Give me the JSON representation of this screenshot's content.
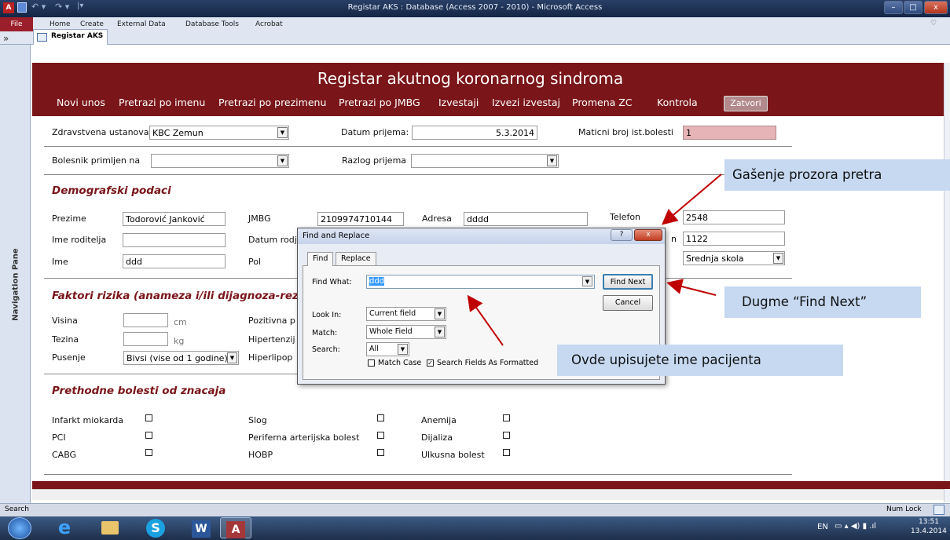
{
  "window": {
    "title": "Registar AKS : Database (Access 2007 - 2010)  -  Microsoft Access"
  },
  "ribbon": {
    "file": "File",
    "tabs": [
      "Home",
      "Create",
      "External Data",
      "Database Tools",
      "Acrobat"
    ]
  },
  "doc_tab": {
    "label": "Registar AKS",
    "chevron": "»"
  },
  "nav_pane": {
    "label": "Navigation Pane"
  },
  "form": {
    "title": "Registar akutnog koronarnog sindroma",
    "menu": [
      "Novi unos",
      "Pretrazi po imenu",
      "Pretrazi po prezimenu",
      "Pretrazi po JMBG",
      "Izvestaji",
      "Izvezi izvestaj",
      "Promena ZC",
      "Kontrola"
    ],
    "close_button": "Zatvori",
    "zdravstvena_label": "Zdravstvena ustanova:",
    "zdravstvena_value": "KBC Zemun",
    "datum_prijema_label": "Datum prijema:",
    "datum_prijema_value": "5.3.2014",
    "maticni_label": "Maticni broj ist.bolesti",
    "maticni_value": "1",
    "bolesnik_label": "Bolesnik primljen na",
    "razlog_label": "Razlog prijema",
    "demo_heading": "Demografski podaci",
    "prezime_label": "Prezime",
    "prezime_value": "Todorović Janković",
    "jmbg_label": "JMBG",
    "jmbg_value": "2109974710144",
    "adresa_label": "Adresa",
    "adresa_value": "dddd",
    "telefon_label": "Telefon",
    "telefon_value": "2548",
    "roditelj_label": "Ime roditelja",
    "datum_rodj_label": "Datum rodj",
    "right_partial": "n",
    "right_value": "1122",
    "ime_label": "Ime",
    "ime_value": "ddd",
    "pol_label": "Pol",
    "obrazovanje_value": "Srednja skola",
    "faktori_heading": "Faktori rizika (anameza i/ili dijagnoza-rezult",
    "visina_label": "Visina",
    "visina_unit": "cm",
    "tezina_label": "Tezina",
    "tezina_unit": "kg",
    "pusenje_label": "Pusenje",
    "pusenje_value": "Bivsi (vise od 1 godine)",
    "pozitivna_label": "Pozitivna p",
    "hipertenzija_label": "Hipertenzij",
    "hiperlipo_label": "Hiperlipop",
    "prethodne_heading": "Prethodne bolesti od znacaja",
    "diseases": [
      [
        "Infarkt miokarda",
        "Slog",
        "Anemija"
      ],
      [
        "PCI",
        "Periferna arterijska bolest",
        "Dijaliza"
      ],
      [
        "CABG",
        "HOBP",
        "Ulkusna bolest"
      ]
    ]
  },
  "dialog": {
    "title": "Find and Replace",
    "help": "?",
    "close": "x",
    "tab_find": "Find",
    "tab_replace": "Replace",
    "find_what_label": "Find What:",
    "find_what_value": "ddd",
    "find_next": "Find Next",
    "cancel": "Cancel",
    "look_in_label": "Look In:",
    "look_in_value": "Current field",
    "match_label": "Match:",
    "match_value": "Whole Field",
    "search_label": "Search:",
    "search_value": "All",
    "match_case": "Match Case",
    "search_formatted": "Search Fields As Formatted"
  },
  "callouts": {
    "top": "Gašenje prozora pretra",
    "find_next": "Dugme “Find Next”",
    "input": "Ovde upisujete  ime pacijenta"
  },
  "status": {
    "left": "Search",
    "right": "Num Lock"
  },
  "taskbar": {
    "lang": "EN",
    "time": "13:51",
    "date": "13.4.2014"
  },
  "colors": {
    "form_header": "#7a1519",
    "required_field": "#e6b4b6",
    "callout_bg": "#c6d9f1",
    "arrow": "#c00000"
  }
}
